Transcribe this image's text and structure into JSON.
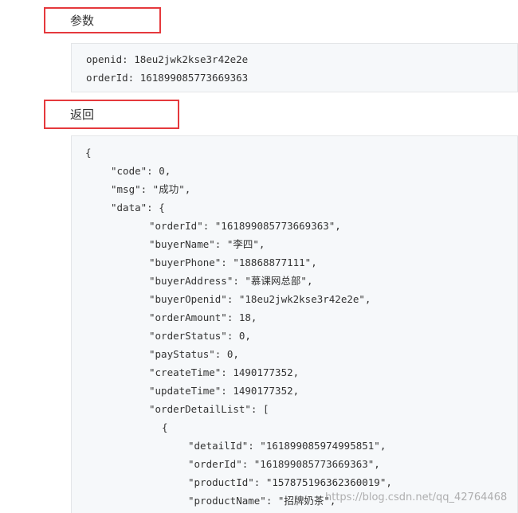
{
  "params": {
    "heading": "参数",
    "lines": [
      "openid: 18eu2jwk2kse3r42e2e",
      "orderId: 161899085773669363"
    ]
  },
  "response": {
    "heading": "返回",
    "lines": [
      "{",
      "\"code\": 0,",
      "\"msg\": \"成功\",",
      "\"data\": {",
      "\"orderId\": \"161899085773669363\",",
      "\"buyerName\": \"李四\",",
      "\"buyerPhone\": \"18868877111\",",
      "\"buyerAddress\": \"慕课网总部\",",
      "\"buyerOpenid\": \"18eu2jwk2kse3r42e2e\",",
      "\"orderAmount\": 18,",
      "\"orderStatus\": 0,",
      "\"payStatus\": 0,",
      "\"createTime\": 1490177352,",
      "\"updateTime\": 1490177352,",
      "\"orderDetailList\": [",
      "{",
      "\"detailId\": \"161899085974995851\",",
      "\"orderId\": \"161899085773669363\",",
      "\"productId\": \"157875196362360019\",",
      "\"productName\": \"招牌奶茶\","
    ]
  },
  "watermark": "https://blog.csdn.net/qq_42764468"
}
